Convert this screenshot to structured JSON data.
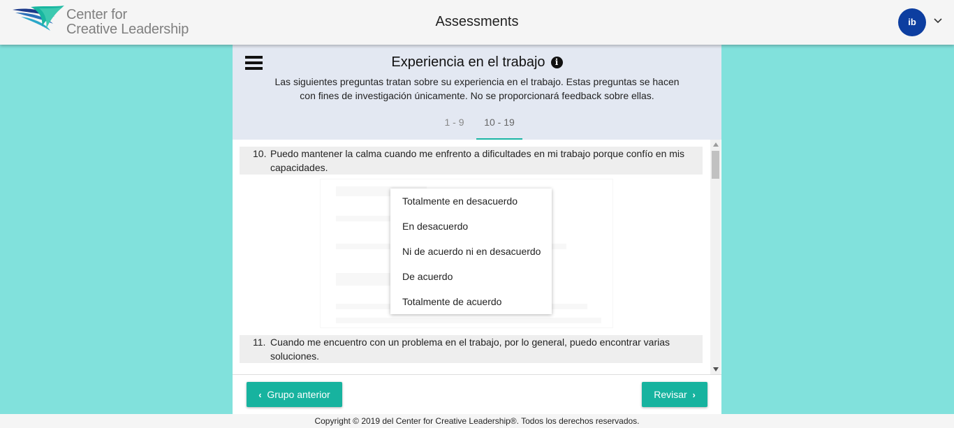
{
  "header": {
    "logo_text_line1": "Center for",
    "logo_text_line2": "Creative Leadership",
    "title": "Assessments",
    "avatar_initials": "ib"
  },
  "section": {
    "title": "Experiencia en el trabajo",
    "description": "Las siguientes preguntas tratan sobre su experiencia en el trabajo. Estas preguntas se hacen con fines de investigación únicamente. No se proporcionará feedback sobre ellas.",
    "tabs": [
      {
        "label": "1 - 9",
        "active": false
      },
      {
        "label": "10 - 19",
        "active": true
      }
    ]
  },
  "questions": [
    {
      "number": "10.",
      "text": "Puedo mantener la calma cuando me enfrento a dificultades en mi trabajo porque confío en mis capacidades."
    },
    {
      "number": "11.",
      "text": "Cuando me encuentro con un problema en el trabajo, por lo general, puedo encontrar varias soluciones."
    }
  ],
  "dropdown_options": [
    "Totalmente en desacuerdo",
    "En desacuerdo",
    "Ni de acuerdo ni en desacuerdo",
    "De acuerdo",
    "Totalmente de acuerdo"
  ],
  "buttons": {
    "previous": "Grupo anterior",
    "next": "Revisar"
  },
  "footer": {
    "copyright": "Copyright © 2019 del Center for Creative Leadership®. Todos los derechos reservados."
  },
  "colors": {
    "background": "#81e1dc",
    "accent": "#17b39f",
    "avatar": "#0d3ea0",
    "panel_header": "#e3e8f2"
  }
}
